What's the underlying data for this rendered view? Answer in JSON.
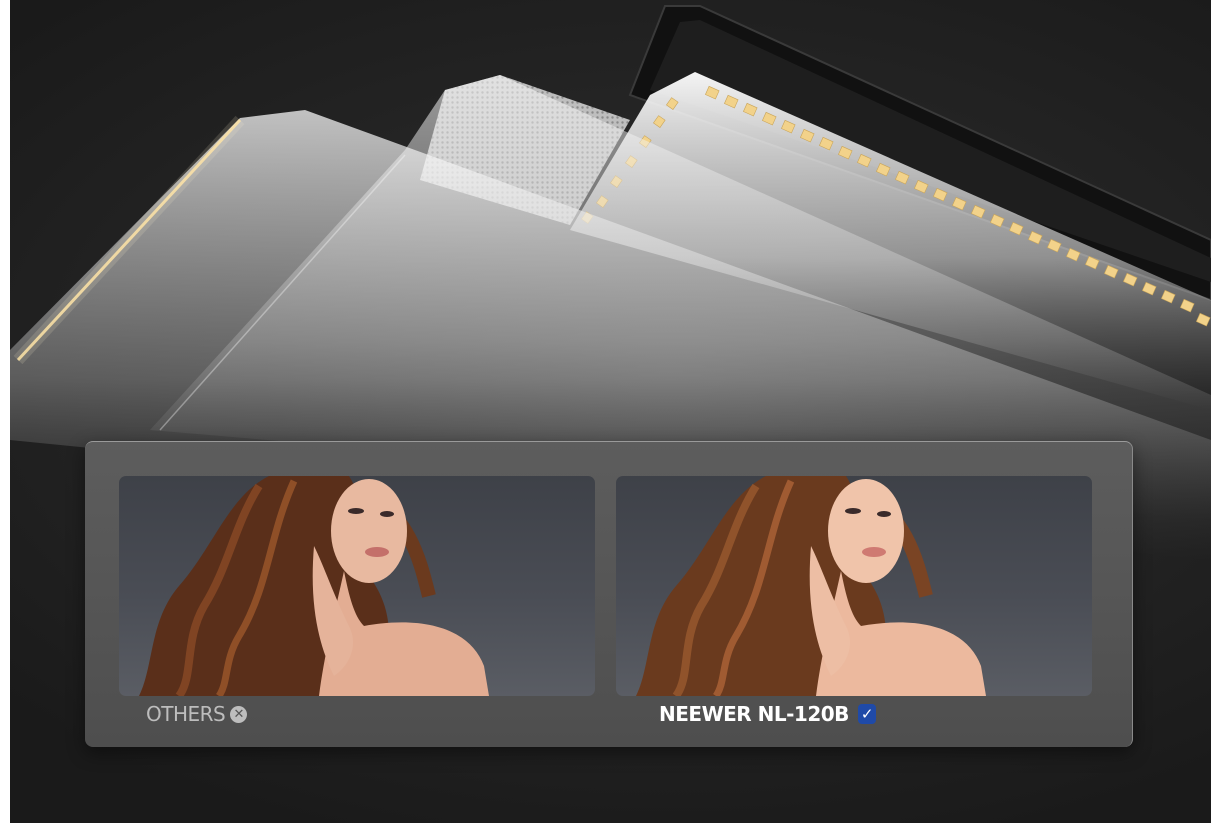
{
  "comparison": {
    "others_label": "OTHERS",
    "others_icon": "x-circle-icon",
    "neewer_label": "NEEWER NL-120B",
    "neewer_icon": "checkmark-icon"
  },
  "colors": {
    "background": "#262626",
    "panel": "#585858",
    "led": "#f2d28a",
    "check_badge": "#1f4aa8"
  }
}
